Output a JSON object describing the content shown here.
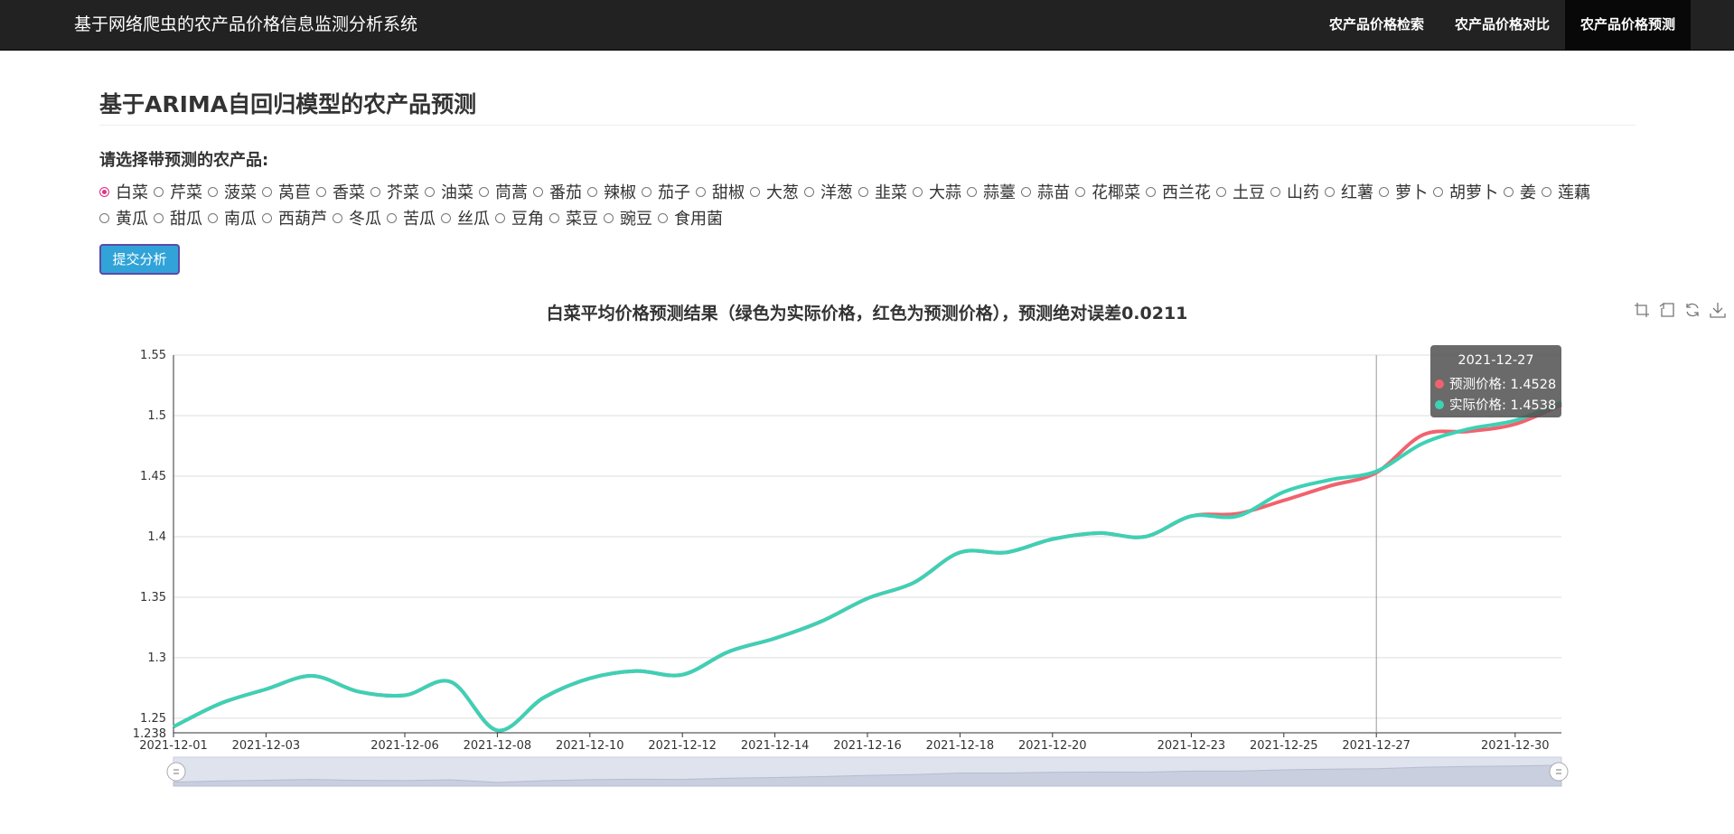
{
  "navbar": {
    "brand": "基于网络爬虫的农产品价格信息监测分析系统",
    "items": [
      "农产品价格检索",
      "农产品价格对比",
      "农产品价格预测"
    ],
    "active_index": 2
  },
  "page": {
    "title": "基于ARIMA自回归模型的农产品预测",
    "choose_label": "请选择带预测的农产品:",
    "selected": "白菜",
    "products": [
      "白菜",
      "芹菜",
      "菠菜",
      "莴苣",
      "香菜",
      "芥菜",
      "油菜",
      "茼蒿",
      "番茄",
      "辣椒",
      "茄子",
      "甜椒",
      "大葱",
      "洋葱",
      "韭菜",
      "大蒜",
      "蒜薹",
      "蒜苗",
      "花椰菜",
      "西兰花",
      "土豆",
      "山药",
      "红薯",
      "萝卜",
      "胡萝卜",
      "姜",
      "莲藕",
      "黄瓜",
      "甜瓜",
      "南瓜",
      "西葫芦",
      "冬瓜",
      "苦瓜",
      "丝瓜",
      "豆角",
      "菜豆",
      "豌豆",
      "食用菌"
    ],
    "submit_label": "提交分析"
  },
  "toolbox": [
    "zoom-icon",
    "zoom-reset-icon",
    "restore-icon",
    "download-icon"
  ],
  "tooltip": {
    "date": "2021-12-27",
    "rows": [
      {
        "label": "预测价格: 1.4528",
        "color": "#f0636e"
      },
      {
        "label": "实际价格: 1.4538",
        "color": "#3dd1b5"
      }
    ]
  },
  "colors": {
    "actual": "#3dd1b5",
    "predicted": "#f0636e"
  },
  "chart_data": {
    "type": "line",
    "title": "白菜平均价格预测结果（绿色为实际价格，红色为预测价格），预测绝对误差0.0211",
    "x_dates": [
      "2021-12-01",
      "2021-12-02",
      "2021-12-03",
      "2021-12-04",
      "2021-12-05",
      "2021-12-06",
      "2021-12-07",
      "2021-12-08",
      "2021-12-09",
      "2021-12-10",
      "2021-12-11",
      "2021-12-12",
      "2021-12-13",
      "2021-12-14",
      "2021-12-15",
      "2021-12-16",
      "2021-12-17",
      "2021-12-18",
      "2021-12-19",
      "2021-12-20",
      "2021-12-21",
      "2021-12-22",
      "2021-12-23",
      "2021-12-24",
      "2021-12-25",
      "2021-12-26",
      "2021-12-27",
      "2021-12-28",
      "2021-12-29",
      "2021-12-30",
      "2021-12-31"
    ],
    "x_tick_labels": [
      "2021-12-01",
      "2021-12-03",
      "2021-12-06",
      "2021-12-08",
      "2021-12-10",
      "2021-12-12",
      "2021-12-14",
      "2021-12-16",
      "2021-12-18",
      "2021-12-20",
      "2021-12-23",
      "2021-12-25",
      "2021-12-27",
      "2021-12-30"
    ],
    "y_ticks": [
      "1.55",
      "1.5",
      "1.45",
      "1.4",
      "1.35",
      "1.3",
      "1.25",
      "1.238"
    ],
    "ylim": [
      1.238,
      1.55
    ],
    "highlight_date": "2021-12-27",
    "series": [
      {
        "name": "实际价格",
        "color": "#3dd1b5",
        "values": [
          1.243,
          1.262,
          1.274,
          1.285,
          1.272,
          1.269,
          1.28,
          1.24,
          1.267,
          1.283,
          1.289,
          1.286,
          1.305,
          1.316,
          1.33,
          1.349,
          1.362,
          1.387,
          1.387,
          1.398,
          1.403,
          1.4,
          1.417,
          1.417,
          1.437,
          1.447,
          1.454,
          1.477,
          1.489,
          1.496,
          1.511
        ]
      },
      {
        "name": "预测价格",
        "color": "#f0636e",
        "values": [
          1.243,
          1.262,
          1.274,
          1.285,
          1.272,
          1.269,
          1.28,
          1.24,
          1.267,
          1.283,
          1.289,
          1.286,
          1.305,
          1.316,
          1.33,
          1.349,
          1.362,
          1.387,
          1.387,
          1.398,
          1.403,
          1.4,
          1.417,
          1.419,
          1.43,
          1.442,
          1.453,
          1.484,
          1.487,
          1.493,
          1.509
        ]
      }
    ]
  }
}
